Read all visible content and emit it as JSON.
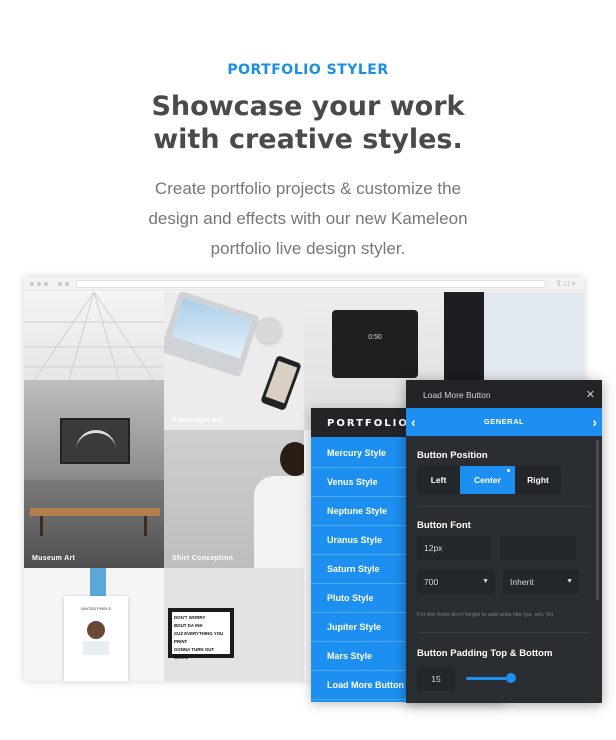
{
  "hero": {
    "eyebrow": "PORTFOLIO STYLER",
    "headline_line1": "Showcase your work",
    "headline_line2": "with creative styles.",
    "sub_line1": "Create portfolio projects & customize the",
    "sub_line2": "design and effects with our new Kameleon",
    "sub_line3": "portfolio live design styler."
  },
  "grid": {
    "tiles": [
      {
        "label": "Passenger Art"
      },
      {
        "label": "Museum Art"
      },
      {
        "label": "Shirt Conception"
      }
    ],
    "phone_time": "0:50",
    "card_name": "UNITED PIXELS",
    "poster_lines": [
      "DON'T WORRY",
      "BOUT DA INK",
      "CUZ EVERYTHING YOU",
      "PRINT",
      "GONNA TURN OUT WHITE"
    ]
  },
  "portfolio_panel": {
    "title": "PORTFOLIO SE",
    "items": [
      "Mercury Style",
      "Venus Style",
      "Neptune Style",
      "Uranus Style",
      "Saturn Style",
      "Pluto Style",
      "Jupiter Style",
      "Mars Style",
      "Load More Button"
    ],
    "colors": {
      "accent": "#1d8ff0",
      "dark": "#222428"
    }
  },
  "settings_panel": {
    "title": "Load More Button",
    "tab": "GENERAL",
    "position_title": "Button Position",
    "positions": [
      "Left",
      "Center",
      "Right"
    ],
    "active_position": "Center",
    "font_title": "Button Font",
    "font_size": "12px",
    "font_weight": "700",
    "font_style": "Inherit",
    "hint": "For the fonts don't forget to add units like (px, em, %)",
    "padding_title": "Button Padding Top & Bottom",
    "padding_value": "15"
  }
}
